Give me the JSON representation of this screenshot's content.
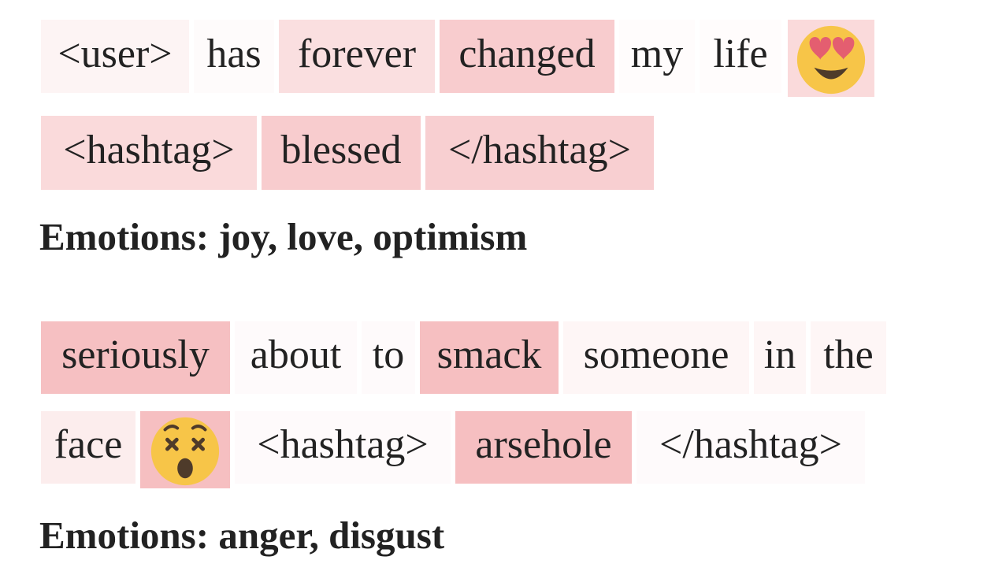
{
  "examples": [
    {
      "tokens": [
        {
          "text": "<user>",
          "intensity": 0.12
        },
        {
          "text": "has",
          "intensity": 0.04
        },
        {
          "text": "forever",
          "intensity": 0.35
        },
        {
          "text": "changed",
          "intensity": 0.55
        },
        {
          "text": "my",
          "intensity": 0.03
        },
        {
          "text": "life",
          "intensity": 0.03
        },
        {
          "text": "",
          "icon": "heart-eyes-emoji-icon",
          "intensity": 0.4
        },
        {
          "text": "<hashtag>",
          "intensity": 0.4
        },
        {
          "text": "blessed",
          "intensity": 0.55
        },
        {
          "text": "</hashtag>",
          "intensity": 0.52
        }
      ],
      "emotions_label": "Emotions: joy, love, optimism"
    },
    {
      "tokens": [
        {
          "text": "seriously",
          "intensity": 0.68
        },
        {
          "text": "about",
          "intensity": 0.05
        },
        {
          "text": "to",
          "intensity": 0.05
        },
        {
          "text": "smack",
          "intensity": 0.7
        },
        {
          "text": "someone",
          "intensity": 0.1
        },
        {
          "text": "in",
          "intensity": 0.1
        },
        {
          "text": "the",
          "intensity": 0.1
        },
        {
          "text": "face",
          "intensity": 0.2
        },
        {
          "text": "",
          "icon": "dizzy-face-emoji-icon",
          "intensity": 0.7
        },
        {
          "text": "<hashtag>",
          "intensity": 0.05
        },
        {
          "text": "arsehole",
          "intensity": 0.7
        },
        {
          "text": "</hashtag>",
          "intensity": 0.05
        }
      ],
      "emotions_label": "Emotions: anger, disgust"
    }
  ],
  "colors": {
    "highlight_max": "#f2a3a6",
    "text": "#222222",
    "emoji_face": "#f7c548",
    "emoji_heart": "#e45e70",
    "emoji_dark": "#4e3b2a"
  }
}
